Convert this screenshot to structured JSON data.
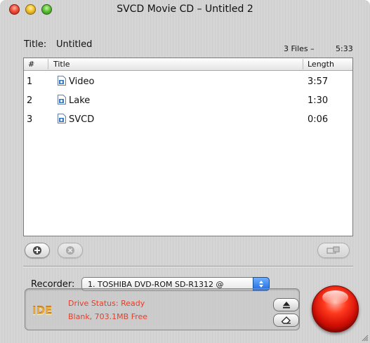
{
  "window": {
    "title": "SVCD Movie CD – Untitled 2"
  },
  "document": {
    "title_label": "Title:",
    "title_value": "Untitled",
    "files_count": "3 Files  –",
    "total_length": "5:33"
  },
  "table": {
    "headers": {
      "num": "#",
      "title": "Title",
      "length": "Length"
    },
    "rows": [
      {
        "num": "1",
        "title": "Video",
        "length": "3:57",
        "icon": "document-icon"
      },
      {
        "num": "2",
        "title": "Lake",
        "length": "1:30",
        "icon": "document-icon"
      },
      {
        "num": "3",
        "title": "SVCD",
        "length": "0:06",
        "icon": "document-icon"
      }
    ]
  },
  "buttons": {
    "add": "plus-icon",
    "remove": "x-icon",
    "eject": "eject-icon",
    "erase": "eraser-icon",
    "burn": "burn-icon"
  },
  "recorder": {
    "label": "Recorder:",
    "selected": "1. TOSHIBA DVD-ROM SD-R1312 @"
  },
  "status": {
    "interface_logo": "IDE",
    "drive_status": "Drive Status: Ready",
    "media": "Blank, 703.1MB Free"
  },
  "colors": {
    "status_text": "#e0402a",
    "burn_button": "#d41006",
    "ide_logo": "#e7a53a"
  }
}
